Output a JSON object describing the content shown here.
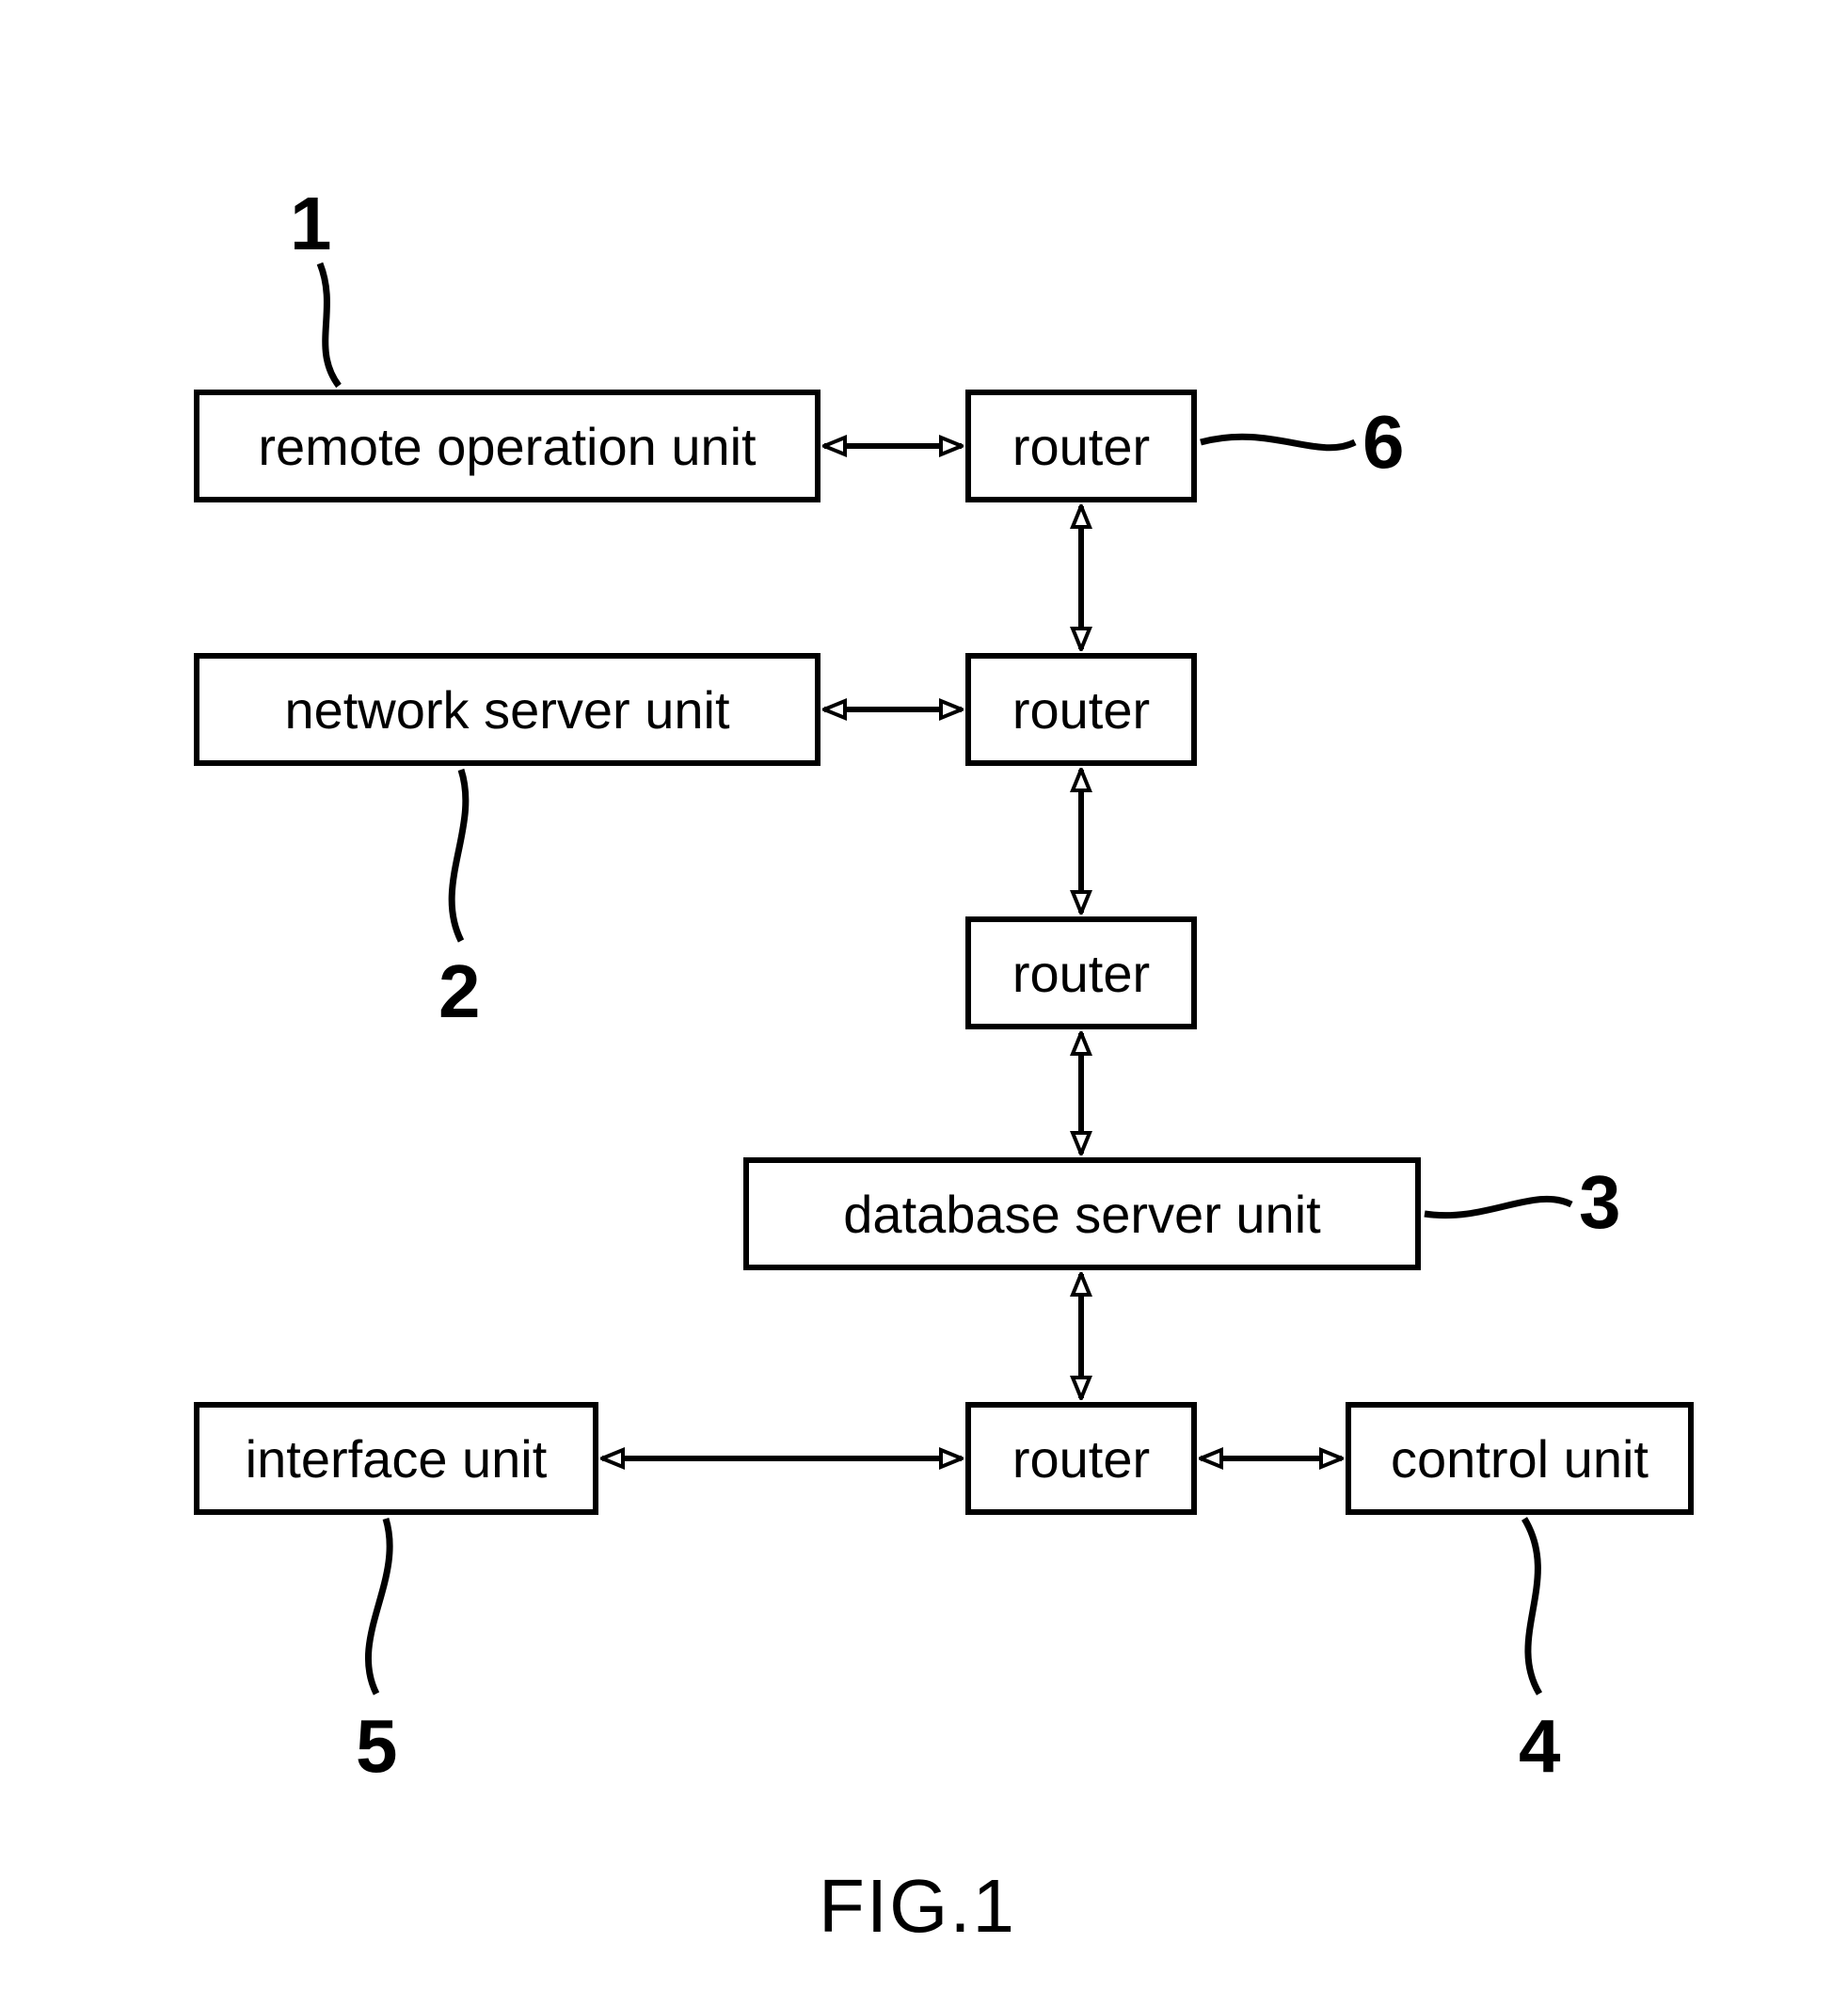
{
  "boxes": {
    "remote_operation_unit": "remote operation unit",
    "router_top": "router",
    "network_server_unit": "network server unit",
    "router_2": "router",
    "router_3": "router",
    "database_server_unit": "database server unit",
    "interface_unit": "interface unit",
    "router_bottom": "router",
    "control_unit": "control unit"
  },
  "refs": {
    "r1": "1",
    "r2": "2",
    "r3": "3",
    "r4": "4",
    "r5": "5",
    "r6": "6"
  },
  "figure_label": "FIG.1"
}
